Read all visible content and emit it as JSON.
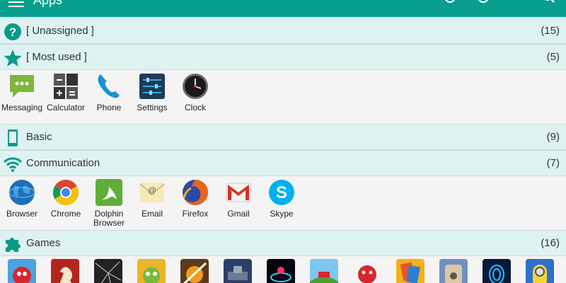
{
  "header": {
    "title": "Apps",
    "color": "#089f8e"
  },
  "sections": [
    {
      "label": "[ Unassigned ]",
      "count": "(15)",
      "icon": "help-circle-icon"
    },
    {
      "label": "[ Most used ]",
      "count": "(5)",
      "icon": "star-icon"
    },
    {
      "label": "Basic",
      "count": "(9)",
      "icon": "phone-device-icon"
    },
    {
      "label": "Communication",
      "count": "(7)",
      "icon": "wifi-icon"
    },
    {
      "label": "Games",
      "count": "(16)",
      "icon": "puzzle-icon"
    }
  ],
  "most_used": [
    {
      "label": "Messaging",
      "icon": "messaging-icon"
    },
    {
      "label": "Calculator",
      "icon": "calculator-icon"
    },
    {
      "label": "Phone",
      "icon": "phone-icon"
    },
    {
      "label": "Settings",
      "icon": "settings-icon"
    },
    {
      "label": "Clock",
      "icon": "clock-icon"
    }
  ],
  "communication": [
    {
      "label": "Browser",
      "icon": "globe-icon"
    },
    {
      "label": "Chrome",
      "icon": "chrome-icon"
    },
    {
      "label": "Dolphin Browser",
      "icon": "dolphin-icon"
    },
    {
      "label": "Email",
      "icon": "email-icon"
    },
    {
      "label": "Firefox",
      "icon": "firefox-icon"
    },
    {
      "label": "Gmail",
      "icon": "gmail-icon"
    },
    {
      "label": "Skype",
      "icon": "skype-icon"
    }
  ],
  "games": [
    "angry-birds-icon",
    "chess-icon",
    "cracked-screen-icon",
    "cut-the-rope-icon",
    "fruit-ninja-icon",
    "battle-icon",
    "air-hockey-icon",
    "hill-climb-icon",
    "red-ball-icon",
    "cards-icon",
    "labyrinth-icon",
    "fingerprint-icon",
    "minion-icon"
  ]
}
